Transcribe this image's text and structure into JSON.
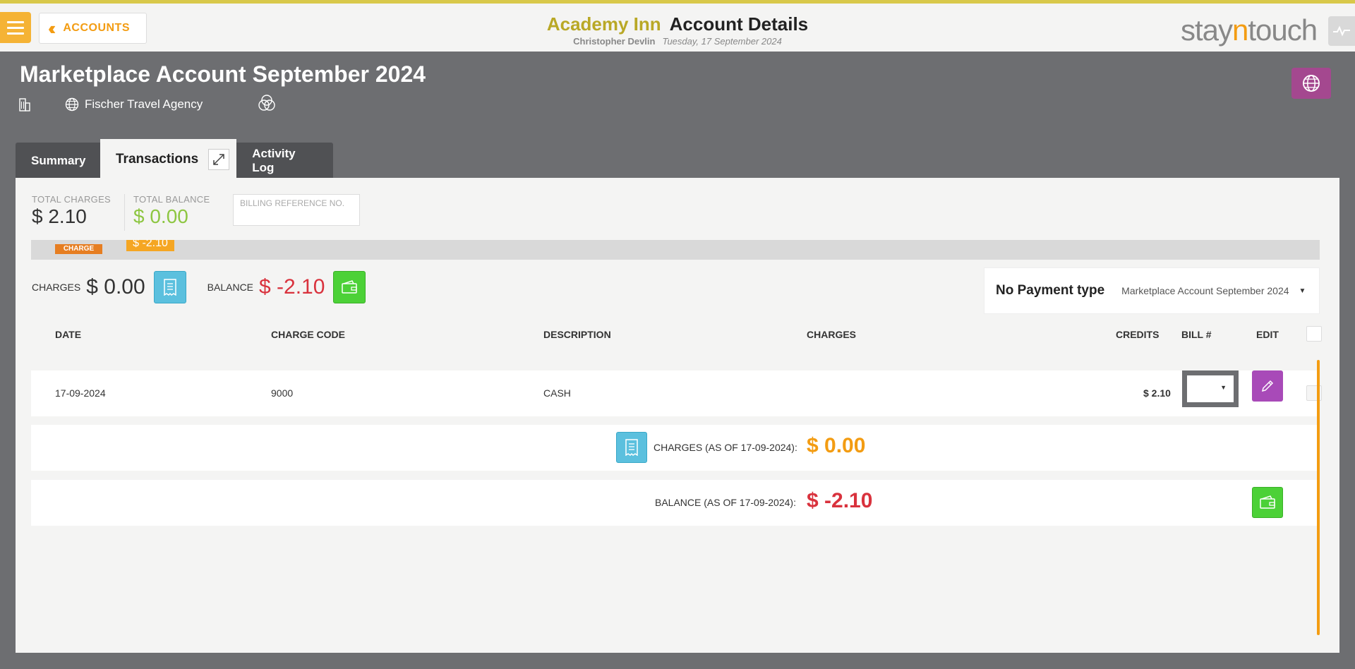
{
  "header": {
    "back_label": "ACCOUNTS",
    "hotel": "Academy Inn",
    "page_title": "Account Details",
    "user": "Christopher Devlin",
    "date": "Tuesday, 17 September 2024",
    "brand_pre": "stay",
    "brand_n": "n",
    "brand_post": "touch"
  },
  "account": {
    "title": "Marketplace Account September 2024",
    "agency": "Fischer Travel Agency"
  },
  "tabs": [
    {
      "label": "Summary"
    },
    {
      "label": "Transactions"
    },
    {
      "label": "Activity Log"
    }
  ],
  "totals": {
    "charges_label": "TOTAL CHARGES",
    "charges_value": "$ 2.10",
    "balance_label": "TOTAL BALANCE",
    "balance_value": "$ 0.00",
    "billing_ref_placeholder": "BILLING REFERENCE NO."
  },
  "bill": {
    "tag_label": "CHARGE",
    "tag_amount": "$ -2.10",
    "charges_label": "CHARGES",
    "charges_value": "$ 0.00",
    "balance_label": "BALANCE",
    "balance_value": "$ -2.10",
    "payment_type_label": "No Payment type",
    "payment_type_selected": "Marketplace Account September 2024"
  },
  "table": {
    "columns": [
      "DATE",
      "CHARGE CODE",
      "DESCRIPTION",
      "CHARGES",
      "CREDITS",
      "BILL #",
      "EDIT"
    ],
    "rows": [
      {
        "date": "17-09-2024",
        "charge_code": "9000",
        "description": "CASH",
        "charges": "",
        "credits": "$ 2.10"
      }
    ]
  },
  "summary": {
    "charges_label": "CHARGES (AS OF 17-09-2024):",
    "charges_value": "$ 0.00",
    "balance_label": "BALANCE (AS OF 17-09-2024):",
    "balance_value": "$ -2.10"
  },
  "colors": {
    "accent": "#f39c12",
    "hotel": "#b9a826",
    "negative": "#d9323d",
    "positive": "#8dc641",
    "edit": "#a84ab8"
  }
}
